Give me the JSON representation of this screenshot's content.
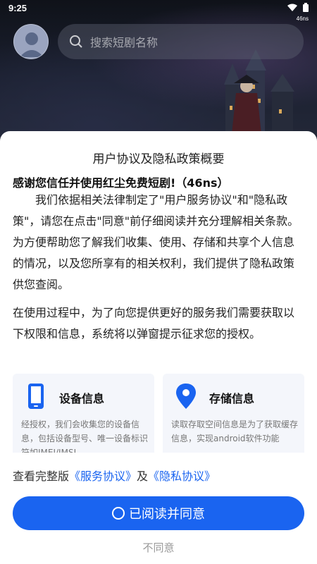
{
  "status": {
    "time": "9:25",
    "app_tag": "46ns"
  },
  "header": {
    "search_placeholder": "搜索短剧名称"
  },
  "dialog": {
    "title": "用户协议及隐私政策概要",
    "thanks": "感谢您信任并使用红尘免费短剧!（46ns）",
    "paragraph1": "我们依据相关法律制定了\"用户服务协议\"和\"隐私政策\"，请您在点击\"同意\"前仔细阅读并充分理解相关条款。为方便帮助您了解我们收集、使用、存储和共享个人信息的情况，以及您所享有的相关权利，我们提供了隐私政策供您查阅。",
    "paragraph2": "在使用过程中，为了向您提供更好的服务我们需要获取以下权限和信息，系统将以弹窗提示征求您的授权。",
    "cards": [
      {
        "icon": "phone-icon",
        "title": "设备信息",
        "body": "经授权，我们会收集您的设备信息，包括设备型号、唯一设备标识符如IMEI/IMSI"
      },
      {
        "icon": "location-pin-icon",
        "title": "存储信息",
        "body": "读取存取空间信息是为了获取缓存信息，实现android软件功能"
      }
    ],
    "links_prefix": "查看完整版",
    "service_link": "《服务协议》",
    "links_and": "及",
    "privacy_link": "《隐私协议》",
    "agree_label": "已阅读并同意",
    "disagree_label": "不同意"
  },
  "colors": {
    "accent": "#1a64f0"
  }
}
